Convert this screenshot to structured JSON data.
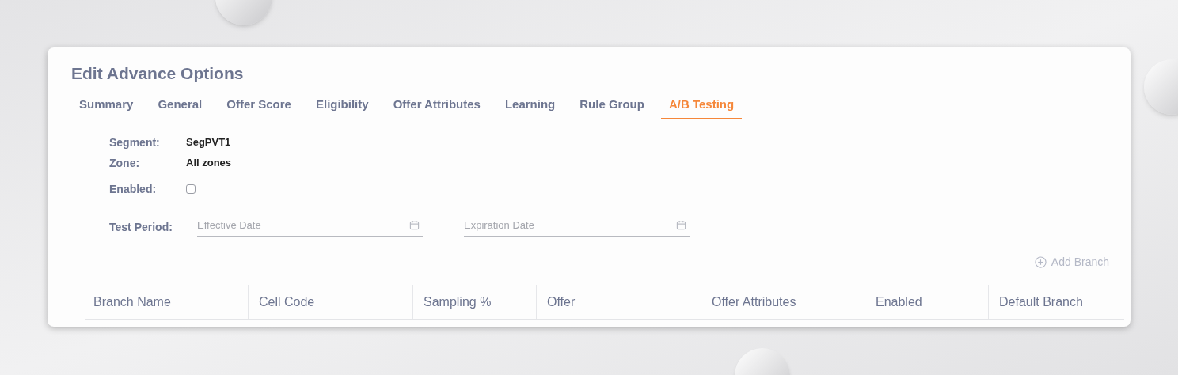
{
  "title": "Edit Advance Options",
  "tabs": [
    {
      "label": "Summary",
      "selected": false
    },
    {
      "label": "General",
      "selected": false
    },
    {
      "label": "Offer Score",
      "selected": false
    },
    {
      "label": "Eligibility",
      "selected": false
    },
    {
      "label": "Offer Attributes",
      "selected": false
    },
    {
      "label": "Learning",
      "selected": false
    },
    {
      "label": "Rule Group",
      "selected": false
    },
    {
      "label": "A/B Testing",
      "selected": true
    }
  ],
  "info": [
    {
      "label": "Segment:",
      "value": "SegPVT1"
    },
    {
      "label": "Zone:",
      "value": "All zones"
    }
  ],
  "enabled": {
    "label": "Enabled:",
    "checked": false
  },
  "test_period": {
    "label": "Test Period:",
    "fields": [
      {
        "placeholder": "Effective Date"
      },
      {
        "placeholder": "Expiration Date"
      }
    ]
  },
  "add_branch": {
    "label": "Add Branch",
    "disabled": true
  },
  "table": {
    "columns": [
      "Branch Name",
      "Cell Code",
      "Sampling %",
      "Offer",
      "Offer Attributes",
      "Enabled",
      "Default Branch"
    ]
  }
}
